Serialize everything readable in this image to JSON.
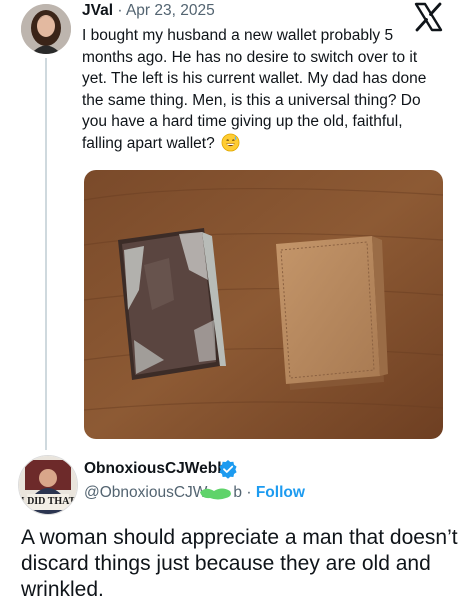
{
  "post": {
    "author_name": "JVal",
    "separator": "·",
    "date": "Apr 23, 2025",
    "text": "I bought my husband a new wallet probably 5 months ago. He has no desire to switch over to it yet. The left is his current wallet. My dad has done the same thing. Men, is this a universal thing? Do you have a hard time giving up the old, faithful, falling apart wallet?",
    "emoji": "grinning-sweat-emoji"
  },
  "reply": {
    "name": "ObnoxiousCJWebb",
    "handle": "@ObnoxiousCJW",
    "handle_tail": "b",
    "separator": "·",
    "follow_label": "Follow",
    "avatar_caption": "I DID THAT",
    "text": "A woman should appreciate a man that doesn’t discard things just because they are old and wrinkled."
  },
  "icons": {
    "brand": "x-logo-icon",
    "verified": "verified-badge-icon"
  },
  "colors": {
    "accent": "#1d9bf0",
    "secondary_text": "#536471",
    "thread_line": "#cfd9de"
  }
}
